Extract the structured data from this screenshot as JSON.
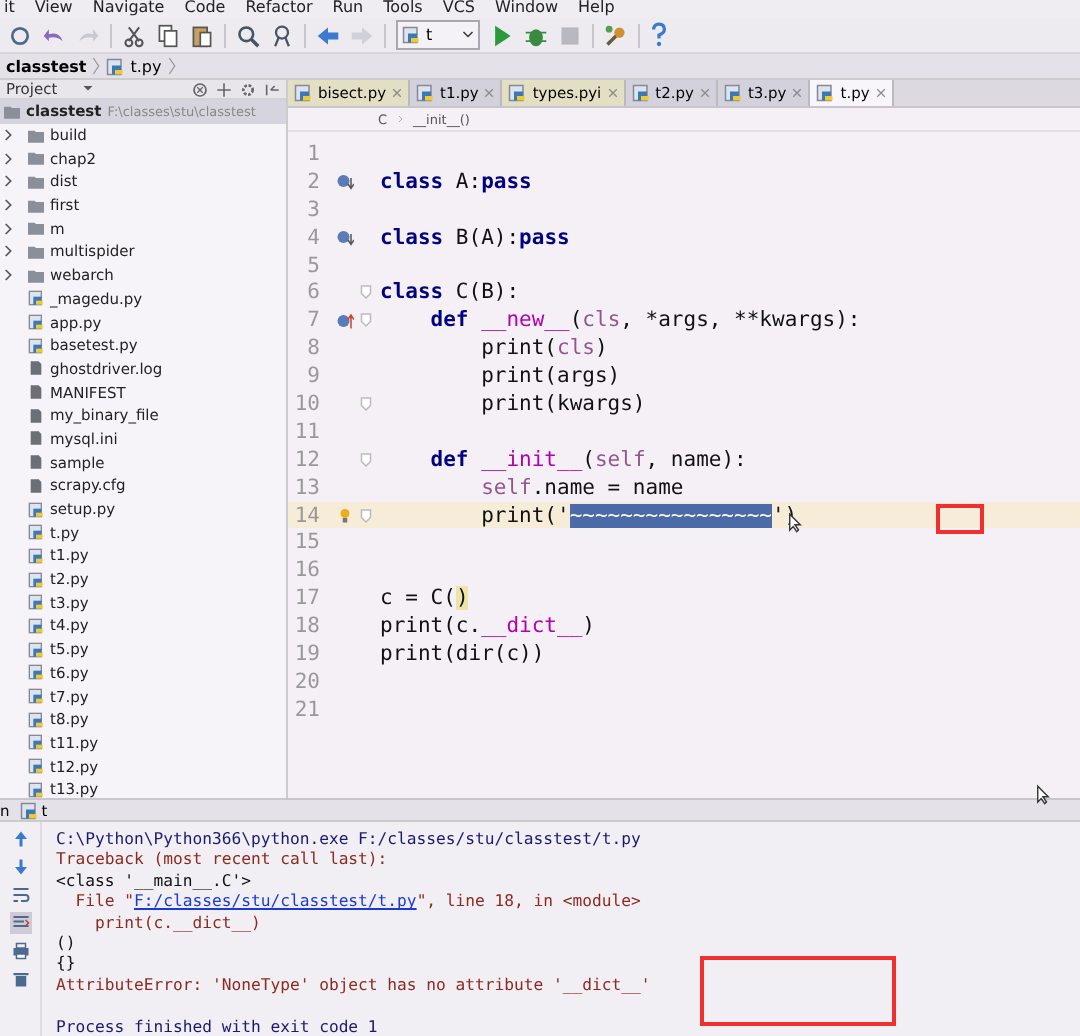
{
  "menu": [
    "it",
    "View",
    "Navigate",
    "Code",
    "Refactor",
    "Run",
    "Tools",
    "VCS",
    "Window",
    "Help"
  ],
  "toolbar": {
    "run_config": "t"
  },
  "nav_bar": [
    "classtest",
    "t.py"
  ],
  "project_panel": {
    "title": "Project",
    "root": {
      "name": "classtest",
      "path": "F:\\classes\\stu\\classtest",
      "selected": true
    },
    "items": [
      {
        "name": "build",
        "kind": "folder",
        "selected": false
      },
      {
        "name": "chap2",
        "kind": "folder",
        "selected": false
      },
      {
        "name": "dist",
        "kind": "folder",
        "selected": false
      },
      {
        "name": "first",
        "kind": "folder",
        "selected": false
      },
      {
        "name": "m",
        "kind": "folder",
        "selected": false
      },
      {
        "name": "multispider",
        "kind": "folder",
        "selected": false
      },
      {
        "name": "webarch",
        "kind": "folder",
        "selected": false
      },
      {
        "name": "_magedu.py",
        "kind": "python",
        "selected": false
      },
      {
        "name": "app.py",
        "kind": "python",
        "selected": false
      },
      {
        "name": "basetest.py",
        "kind": "python",
        "selected": false
      },
      {
        "name": "ghostdriver.log",
        "kind": "file",
        "selected": false
      },
      {
        "name": "MANIFEST",
        "kind": "file",
        "selected": false
      },
      {
        "name": "my_binary_file",
        "kind": "file",
        "selected": false
      },
      {
        "name": "mysql.ini",
        "kind": "file",
        "selected": false
      },
      {
        "name": "sample",
        "kind": "file",
        "selected": false
      },
      {
        "name": "scrapy.cfg",
        "kind": "file",
        "selected": false
      },
      {
        "name": "setup.py",
        "kind": "python",
        "selected": false
      },
      {
        "name": "t.py",
        "kind": "python",
        "selected": false
      },
      {
        "name": "t1.py",
        "kind": "python",
        "selected": false
      },
      {
        "name": "t2.py",
        "kind": "python",
        "selected": false
      },
      {
        "name": "t3.py",
        "kind": "python",
        "selected": false
      },
      {
        "name": "t4.py",
        "kind": "python",
        "selected": false
      },
      {
        "name": "t5.py",
        "kind": "python",
        "selected": false
      },
      {
        "name": "t6.py",
        "kind": "python",
        "selected": false
      },
      {
        "name": "t7.py",
        "kind": "python",
        "selected": false
      },
      {
        "name": "t8.py",
        "kind": "python",
        "selected": false
      },
      {
        "name": "t11.py",
        "kind": "python",
        "selected": false
      },
      {
        "name": "t12.py",
        "kind": "python",
        "selected": false
      },
      {
        "name": "t13.py",
        "kind": "python",
        "selected": false
      }
    ]
  },
  "tabs": [
    {
      "label": "bisect.py",
      "selected": false,
      "library": true
    },
    {
      "label": "t1.py",
      "selected": false,
      "library": false
    },
    {
      "label": "types.pyi",
      "selected": false,
      "library": true
    },
    {
      "label": "t2.py",
      "selected": false,
      "library": false
    },
    {
      "label": "t3.py",
      "selected": false,
      "library": false
    },
    {
      "label": "t.py",
      "selected": true,
      "library": false
    }
  ],
  "editor_breadcrumb": [
    "C",
    "__init__()"
  ],
  "lines": [
    {
      "number": "1",
      "current": false,
      "fold": false
    },
    {
      "number": "2",
      "current": false,
      "fold": false,
      "gutter": {
        "kind": "down"
      },
      "tokens": [
        {
          "kind": "kw",
          "text": "class"
        },
        {
          "kind": "plain",
          "text": " A:"
        },
        {
          "kind": "kw",
          "text": "pass"
        }
      ]
    },
    {
      "number": "3",
      "current": false,
      "fold": false
    },
    {
      "number": "4",
      "current": false,
      "fold": false,
      "gutter": {
        "kind": "down"
      },
      "tokens": [
        {
          "kind": "kw",
          "text": "class"
        },
        {
          "kind": "plain",
          "text": " B(A):"
        },
        {
          "kind": "kw",
          "text": "pass"
        }
      ]
    },
    {
      "number": "5",
      "current": false,
      "fold": false
    },
    {
      "number": "6",
      "current": false,
      "fold": true,
      "tokens": [
        {
          "kind": "kw",
          "text": "class"
        },
        {
          "kind": "plain",
          "text": " C(B):"
        }
      ]
    },
    {
      "number": "7",
      "current": false,
      "fold": true,
      "gutter": {
        "kind": "up"
      },
      "tokens": [
        {
          "kind": "kw",
          "text": "    def "
        },
        {
          "kind": "magic",
          "text": "__new__"
        },
        {
          "kind": "plain",
          "text": "("
        },
        {
          "kind": "self",
          "text": "cls"
        },
        {
          "kind": "plain",
          "text": ", *args, **kwargs):"
        }
      ]
    },
    {
      "number": "8",
      "current": false,
      "fold": false,
      "tokens": [
        {
          "kind": "plain",
          "text": "        print("
        },
        {
          "kind": "self",
          "text": "cls"
        },
        {
          "kind": "plain",
          "text": ")"
        }
      ]
    },
    {
      "number": "9",
      "current": false,
      "fold": false,
      "tokens": [
        {
          "kind": "plain",
          "text": "        print(args)"
        }
      ]
    },
    {
      "number": "10",
      "current": false,
      "fold": true,
      "tokens": [
        {
          "kind": "plain",
          "text": "        print(kwargs)"
        }
      ]
    },
    {
      "number": "11",
      "current": false,
      "fold": false
    },
    {
      "number": "12",
      "current": false,
      "fold": true,
      "tokens": [
        {
          "kind": "kw",
          "text": "    def "
        },
        {
          "kind": "magic",
          "text": "__init__"
        },
        {
          "kind": "plain",
          "text": "("
        },
        {
          "kind": "self",
          "text": "self"
        },
        {
          "kind": "plain",
          "text": ", name):"
        }
      ]
    },
    {
      "number": "13",
      "current": false,
      "fold": false,
      "tokens": [
        {
          "kind": "self",
          "text": "        self"
        },
        {
          "kind": "plain",
          "text": ".name = name"
        }
      ]
    },
    {
      "number": "14",
      "current": true,
      "fold": true,
      "gutter": {
        "kind": "bulb"
      },
      "tokens": [
        {
          "kind": "plain",
          "text": "        print('"
        },
        {
          "kind": "sel",
          "text": "~~~~~~~~~~~~~~~~"
        },
        {
          "kind": "plain",
          "text": "')"
        }
      ]
    },
    {
      "number": "15",
      "current": false,
      "fold": false
    },
    {
      "number": "16",
      "current": false,
      "fold": false
    },
    {
      "number": "17",
      "current": false,
      "fold": false,
      "tokens": [
        {
          "kind": "plain",
          "text": "c = C("
        },
        {
          "kind": "match",
          "text": ")"
        }
      ]
    },
    {
      "number": "18",
      "current": false,
      "fold": false,
      "tokens": [
        {
          "kind": "plain",
          "text": "print(c."
        },
        {
          "kind": "magic",
          "text": "__dict__"
        },
        {
          "kind": "plain",
          "text": ")"
        }
      ]
    },
    {
      "number": "19",
      "current": false,
      "fold": false,
      "tokens": [
        {
          "kind": "plain",
          "text": "print(dir(c))"
        }
      ]
    },
    {
      "number": "20",
      "current": false,
      "fold": false
    },
    {
      "number": "21",
      "current": false,
      "fold": false
    }
  ],
  "run_panel": {
    "label": "n",
    "tab": "t",
    "console": [
      [
        {
          "kind": "cmd",
          "text": "C:\\Python\\Python366\\python.exe F:/classes/stu/classtest/t.py"
        }
      ],
      [
        {
          "kind": "err",
          "text": "Traceback (most recent call last):"
        }
      ],
      [
        {
          "kind": "out",
          "text": "<class '__main__.C'>"
        }
      ],
      [
        {
          "kind": "err",
          "text": "  File \""
        },
        {
          "kind": "link",
          "text": "F:/classes/stu/classtest/t.py"
        },
        {
          "kind": "err",
          "text": "\", line 18, in <module>"
        }
      ],
      [
        {
          "kind": "err",
          "text": "    print(c.__dict__)"
        }
      ],
      [
        {
          "kind": "out",
          "text": "()"
        }
      ],
      [
        {
          "kind": "out",
          "text": "{}"
        }
      ],
      [
        {
          "kind": "err",
          "text": "AttributeError: 'NoneType' object has no attribute '__dict__'"
        }
      ],
      [
        {
          "kind": "cmd",
          "text": "Process finished with exit code 1",
          "gap": true
        }
      ]
    ]
  }
}
